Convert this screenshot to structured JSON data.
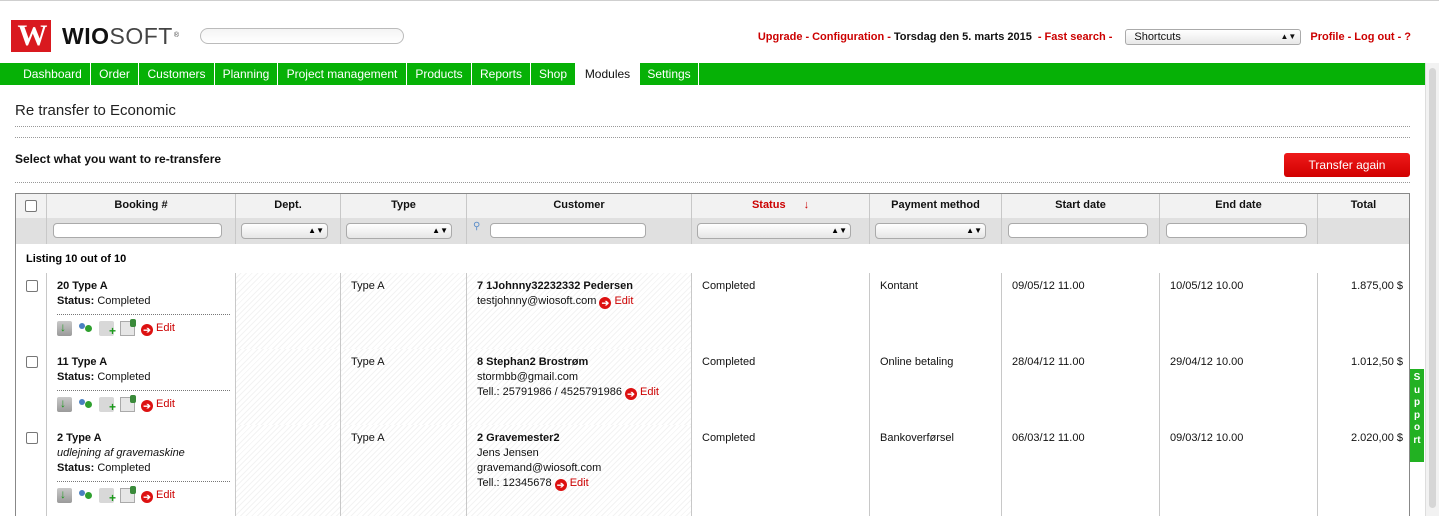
{
  "header": {
    "logo_letter": "W",
    "brand_bold": "WIO",
    "brand_light": "SOFT",
    "brand_mark": "®",
    "links": {
      "upgrade": "Upgrade",
      "configuration": "Configuration",
      "date": "Torsdag den 5. marts 2015",
      "fast_search": "Fast search",
      "shortcuts": "Shortcuts",
      "profile": "Profile",
      "logout": "Log out",
      "help": "?"
    }
  },
  "nav": {
    "items": [
      "Dashboard",
      "Order",
      "Customers",
      "Planning",
      "Project management",
      "Products",
      "Reports",
      "Shop",
      "Modules",
      "Settings"
    ],
    "active": "Modules"
  },
  "page": {
    "title": "Re transfer to Economic",
    "section_title": "Select what you want to re-transfere",
    "transfer_button": "Transfer again"
  },
  "table": {
    "columns": {
      "booking": "Booking #",
      "dept": "Dept.",
      "type": "Type",
      "customer": "Customer",
      "status": "Status",
      "status_sort_icon": "↓",
      "payment": "Payment method",
      "start": "Start date",
      "end": "End date",
      "total": "Total"
    },
    "listing": "Listing 10 out of 10",
    "edit_label": "Edit",
    "status_label": "Status:",
    "rows": [
      {
        "booking": "20 Type A",
        "note": "",
        "status": "Completed",
        "type": "Type A",
        "customer_name": "7 1Johnny32232332 Pedersen",
        "customer_contact": "",
        "customer_email": "testjohnny@wiosoft.com",
        "customer_phone": "",
        "row_status": "Completed",
        "payment": "Kontant",
        "start": "09/05/12 11.00",
        "end": "10/05/12 10.00",
        "total": "1.875,00 $"
      },
      {
        "booking": "11 Type A",
        "note": "",
        "status": "Completed",
        "type": "Type A",
        "customer_name": "8 Stephan2 Brostrøm",
        "customer_contact": "",
        "customer_email": "stormbb@gmail.com",
        "customer_phone": "Tell.: 25791986 / 4525791986",
        "row_status": "Completed",
        "payment": "Online betaling",
        "start": "28/04/12 11.00",
        "end": "29/04/12 10.00",
        "total": "1.012,50 $"
      },
      {
        "booking": "2 Type A",
        "note": "udlejning af gravemaskine",
        "status": "Completed",
        "type": "Type A",
        "customer_name": "2 Gravemester2",
        "customer_contact": "Jens Jensen",
        "customer_email": "gravemand@wiosoft.com",
        "customer_phone": "Tell.: 12345678",
        "row_status": "Completed",
        "payment": "Bankoverførsel",
        "start": "06/03/12 11.00",
        "end": "09/03/12 10.00",
        "total": "2.020,00 $"
      }
    ]
  },
  "support_tab": "Support",
  "colors": {
    "nav_green": "#06b106",
    "accent_red": "#cc0000",
    "logo_red": "#d9191f"
  }
}
